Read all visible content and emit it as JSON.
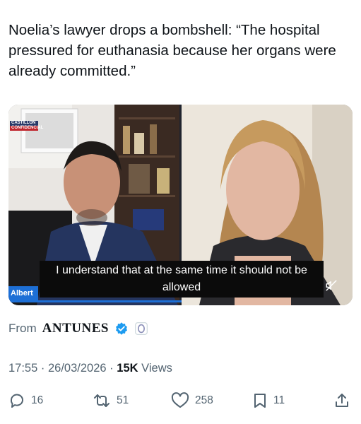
{
  "tweet": {
    "text": "Noelia’s lawyer drops a bombshell: “The hospital pressured for euthanasia because her organs were already committed.”"
  },
  "media": {
    "subtitle_line1": "I understand that at the same time it should not be",
    "subtitle_line2": "allowed",
    "lower_third_name": "Albert",
    "logo_line1": "CASTILLON",
    "logo_line2": "CONFIDENCIAL",
    "mute_icon": "muted-speaker-icon"
  },
  "source": {
    "from_label": "From",
    "account_name": "ANTUNES",
    "badges": [
      "verified-badge-icon",
      "affiliate-badge-icon"
    ]
  },
  "meta": {
    "time": "17:55",
    "separator": "·",
    "date": "26/03/2026",
    "views_count": "15K",
    "views_label": "Views"
  },
  "actions": {
    "replies": "16",
    "reposts": "51",
    "likes": "258",
    "bookmarks": "11",
    "icons": [
      "reply-icon",
      "repost-icon",
      "like-icon",
      "bookmark-icon",
      "share-icon"
    ]
  },
  "colors": {
    "text": "#0f1419",
    "secondary": "#536471",
    "verified": "#1d9bf0",
    "accent_blue": "#1d6fd6"
  }
}
